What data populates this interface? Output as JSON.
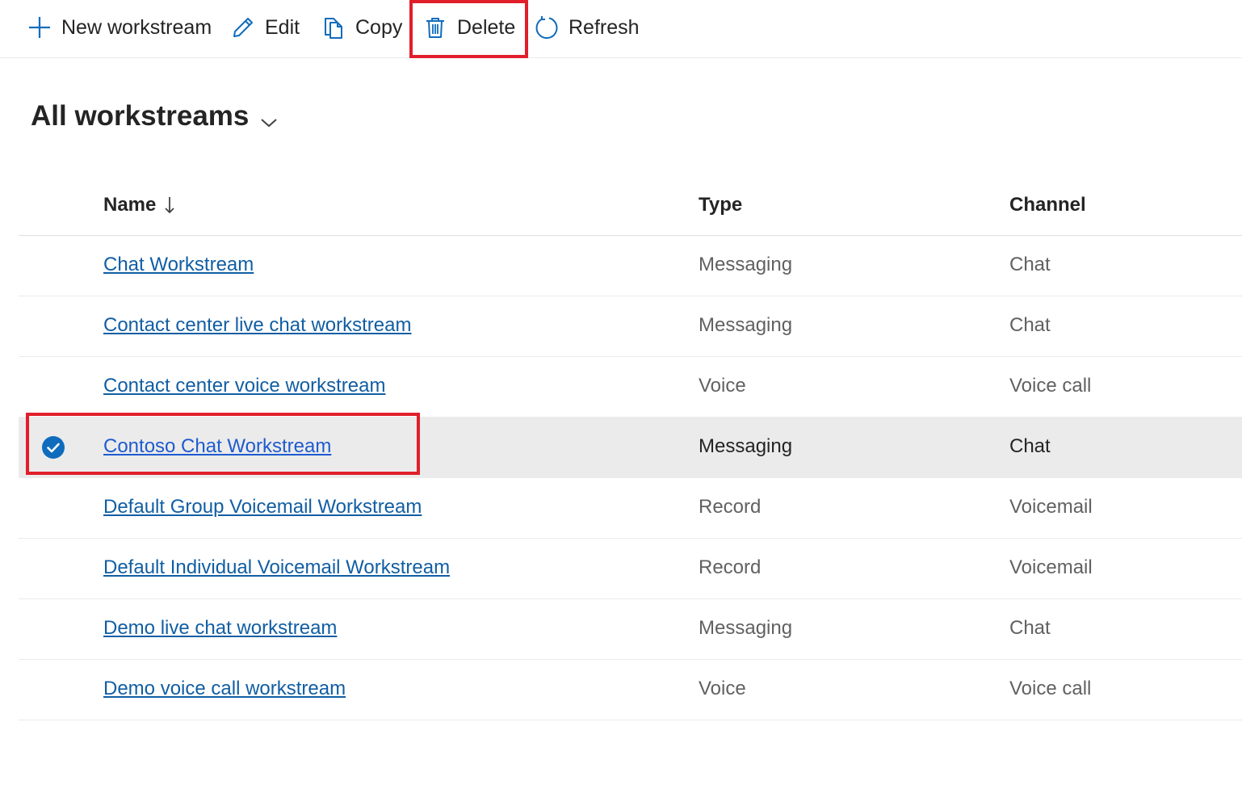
{
  "commands": {
    "new_label": "New workstream",
    "edit_label": "Edit",
    "copy_label": "Copy",
    "delete_label": "Delete",
    "refresh_label": "Refresh"
  },
  "view": {
    "title": "All workstreams"
  },
  "columns": {
    "name": "Name",
    "type": "Type",
    "channel": "Channel"
  },
  "rows": [
    {
      "name": "Chat  Workstream",
      "type": "Messaging",
      "channel": "Chat",
      "selected": false
    },
    {
      "name": "Contact center live chat workstream",
      "type": "Messaging",
      "channel": "Chat",
      "selected": false
    },
    {
      "name": "Contact center voice workstream",
      "type": "Voice",
      "channel": "Voice call",
      "selected": false
    },
    {
      "name": "Contoso Chat Workstream",
      "type": "Messaging",
      "channel": "Chat",
      "selected": true
    },
    {
      "name": "Default Group Voicemail Workstream",
      "type": "Record",
      "channel": "Voicemail",
      "selected": false
    },
    {
      "name": "Default Individual Voicemail Workstream",
      "type": "Record",
      "channel": "Voicemail",
      "selected": false
    },
    {
      "name": "Demo live chat workstream",
      "type": "Messaging",
      "channel": "Chat",
      "selected": false
    },
    {
      "name": "Demo voice call workstream",
      "type": "Voice",
      "channel": "Voice call",
      "selected": false
    }
  ],
  "colors": {
    "accent": "#0f6cbd",
    "link": "#115ea3",
    "highlight": "#e01f2a",
    "selected_row": "#ebebeb"
  },
  "icons": [
    "add-icon",
    "edit-icon",
    "copy-icon",
    "delete-icon",
    "refresh-icon",
    "chevron-down-icon",
    "sort-down-icon",
    "checkmark-circle-icon"
  ]
}
